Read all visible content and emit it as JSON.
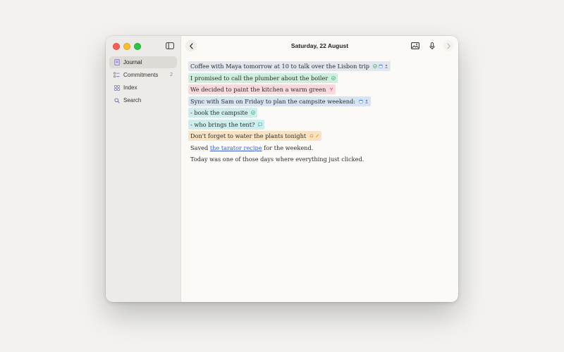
{
  "sidebar": {
    "items": [
      {
        "label": "Journal",
        "icon": "journal-icon",
        "active": true,
        "count": ""
      },
      {
        "label": "Commitments",
        "icon": "commitments-icon",
        "active": false,
        "count": "2"
      },
      {
        "label": "Index",
        "icon": "index-grid-icon",
        "active": false,
        "count": ""
      },
      {
        "label": "Search",
        "icon": "search-icon",
        "active": false,
        "count": ""
      }
    ]
  },
  "header": {
    "date": "Saturday, 22 August"
  },
  "entries": {
    "e1": {
      "text": "Coffee with Maya tomorrow at 10 to talk over the Lisbon trip",
      "color": "#e3e6ec",
      "tags": [
        "check-icon",
        "calendar-icon",
        "person-icon"
      ]
    },
    "e2": {
      "text": "I promised to call the plumber about the boiler",
      "color": "#cfeedd",
      "tags": [
        "check-icon"
      ]
    },
    "e3": {
      "text": "We decided to paint the kitchen a warm green",
      "color": "#f8d9dd",
      "tags": [
        "decision-fork-icon"
      ]
    },
    "e4": {
      "text": "Sync with Sam on Friday to plan the campsite weekend:",
      "color": "#d6e4f3",
      "tags": [
        "calendar-icon",
        "person-icon"
      ]
    },
    "e5": {
      "text": "- book the campsite",
      "color": "#cdeeed",
      "tags": [
        "check-icon"
      ]
    },
    "e6": {
      "text": "- who brings the tent?",
      "color": "#cdeeed",
      "tags": [
        "question-bubble-icon"
      ]
    },
    "e7": {
      "text": "Don't forget to water the plants tonight",
      "color": "#f9e3c5",
      "tags": [
        "bell-icon",
        "pencil-icon"
      ]
    },
    "e8": {
      "prefix": "Saved ",
      "link": "the tarator recipe",
      "suffix": " for the weekend."
    },
    "e9": {
      "text": "Today was one of those days where everything just clicked."
    }
  },
  "colors": {
    "window_bg": "#fbfaf6",
    "sidebar_bg": "#ecebe7",
    "link": "#3a5fc8",
    "tag_green": "#3bb07a",
    "tag_blue": "#4a7fd0",
    "tag_pink": "#d9566b",
    "tag_orange": "#e29a3c"
  }
}
